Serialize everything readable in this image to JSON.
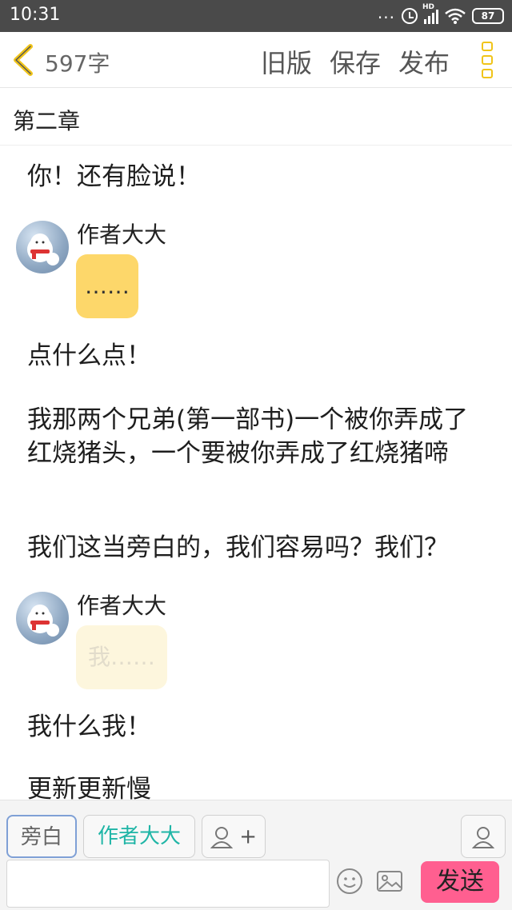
{
  "status_bar": {
    "time": "10:31",
    "more": "...",
    "network": "HD",
    "battery": "87"
  },
  "header": {
    "word_count": "597字",
    "old_version": "旧版",
    "save": "保存",
    "publish": "发布"
  },
  "chapter_title": "第二章",
  "messages": [
    {
      "type": "narration",
      "text": "你！还有脸说！"
    },
    {
      "type": "author",
      "name": "作者大大",
      "text": "……"
    },
    {
      "type": "narration",
      "text": "点什么点！"
    },
    {
      "type": "narration",
      "text": "我那两个兄弟(第一部书)一个被你弄成了红烧猪头，一个要被你弄成了红烧猪啼"
    },
    {
      "type": "narration",
      "text": "我们这当旁白的，我们容易吗？我们？"
    },
    {
      "type": "author",
      "name": "作者大大",
      "text": "我……"
    },
    {
      "type": "narration",
      "text": "我什么我！"
    },
    {
      "type": "narration",
      "text": "更新更新慢"
    }
  ],
  "composer": {
    "narrator_chip": "旁白",
    "author_chip": "作者大大",
    "add_role": "+",
    "input_value": "",
    "send_label": "发送"
  },
  "colors": {
    "accent_yellow": "#f0c419",
    "bubble": "#fdd76a",
    "send": "#ff5f90",
    "author_chip_text": "#1fb5a6"
  }
}
